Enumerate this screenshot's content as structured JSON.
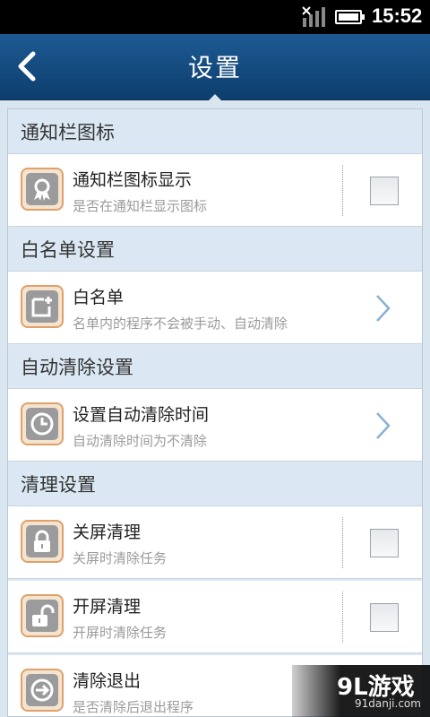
{
  "status_bar": {
    "time": "15:52"
  },
  "title_bar": {
    "title": "设置"
  },
  "sections": [
    {
      "header": "通知栏图标",
      "rows": [
        {
          "label": "通知栏图标显示",
          "sub": "是否在通知栏显示图标",
          "icon": "award-icon",
          "control": "checkbox",
          "checked": false
        }
      ]
    },
    {
      "header": "白名单设置",
      "rows": [
        {
          "label": "白名单",
          "sub": "名单内的程序不会被手动、自动清除",
          "icon": "add-note-icon",
          "control": "chevron"
        }
      ]
    },
    {
      "header": "自动清除设置",
      "rows": [
        {
          "label": "设置自动清除时间",
          "sub": "自动清除时间为不清除",
          "icon": "clock-icon",
          "control": "chevron"
        }
      ]
    },
    {
      "header": "清理设置",
      "rows": [
        {
          "label": "关屏清理",
          "sub": "关屏时清除任务",
          "icon": "lock-icon",
          "control": "checkbox",
          "checked": false
        },
        {
          "label": "开屏清理",
          "sub": "开屏时清除任务",
          "icon": "unlock-icon",
          "control": "checkbox",
          "checked": false
        },
        {
          "label": "清除退出",
          "sub": "是否清除后退出程序",
          "icon": "exit-icon",
          "control": "checkbox",
          "checked": false
        }
      ]
    }
  ],
  "watermark": {
    "brand": "9L游戏",
    "site": "91danji.com"
  },
  "colors": {
    "titlebar": "#164d80",
    "section_bg": "#dbe8f3",
    "icon_border": "#e0a06a"
  }
}
